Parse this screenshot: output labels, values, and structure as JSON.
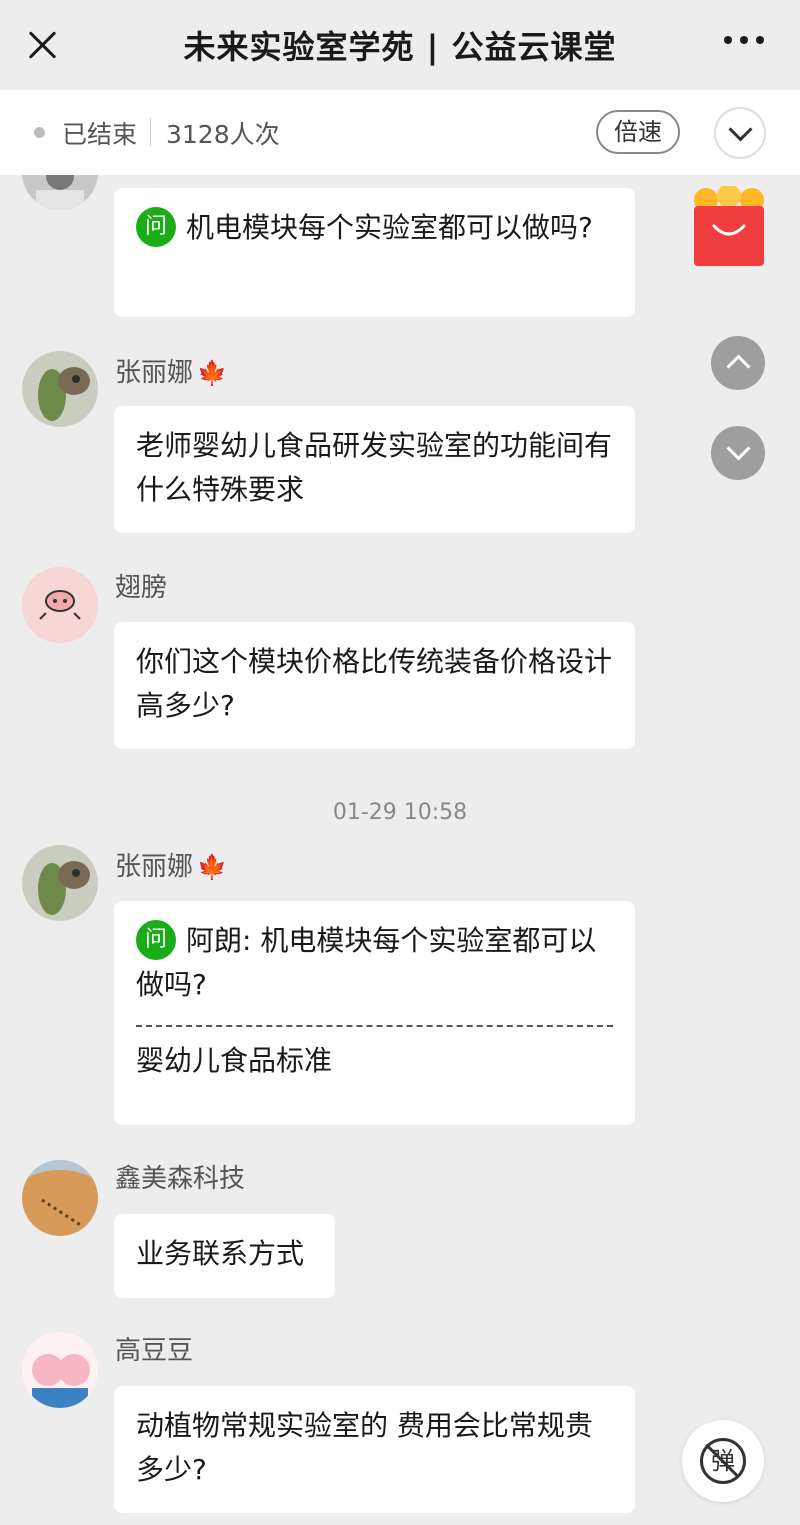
{
  "header": {
    "title": "未来实验室学苑 | 公益云课堂",
    "status": "已结束",
    "viewers": "3128人次",
    "speed_label": "倍速"
  },
  "messages": [
    {
      "q_badge": "问",
      "text": "机电模块每个实验室都可以做吗?"
    },
    {
      "name": "张丽娜",
      "text": "老师婴幼儿食品研发实验室的功能间有什么特殊要求"
    },
    {
      "name": "翅膀",
      "text": "你们这个模块价格比传统装备价格设计高多少?"
    },
    {
      "name": "张丽娜",
      "q_badge": "问",
      "quote": "阿朗: 机电模块每个实验室都可以做吗?",
      "text": "婴幼儿食品标准"
    },
    {
      "name": "鑫美森科技",
      "text": "业务联系方式"
    },
    {
      "name": "高豆豆",
      "text": "动植物常规实验室的 费用会比常规贵多少?"
    }
  ],
  "timestamp": "01-29 10:58",
  "danmaku_label": "弹",
  "icons": {
    "close": "close-icon",
    "more": "more-icon",
    "collapse": "chevron-down-icon",
    "gift": "gift-bag-icon",
    "scroll_up": "chevron-up-icon",
    "scroll_down": "chevron-down-icon",
    "badge": "maple-leaf-icon"
  },
  "colors": {
    "question_badge": "#1aad19",
    "gift_bag": "#f03e3e",
    "badge": "#e8931f"
  }
}
